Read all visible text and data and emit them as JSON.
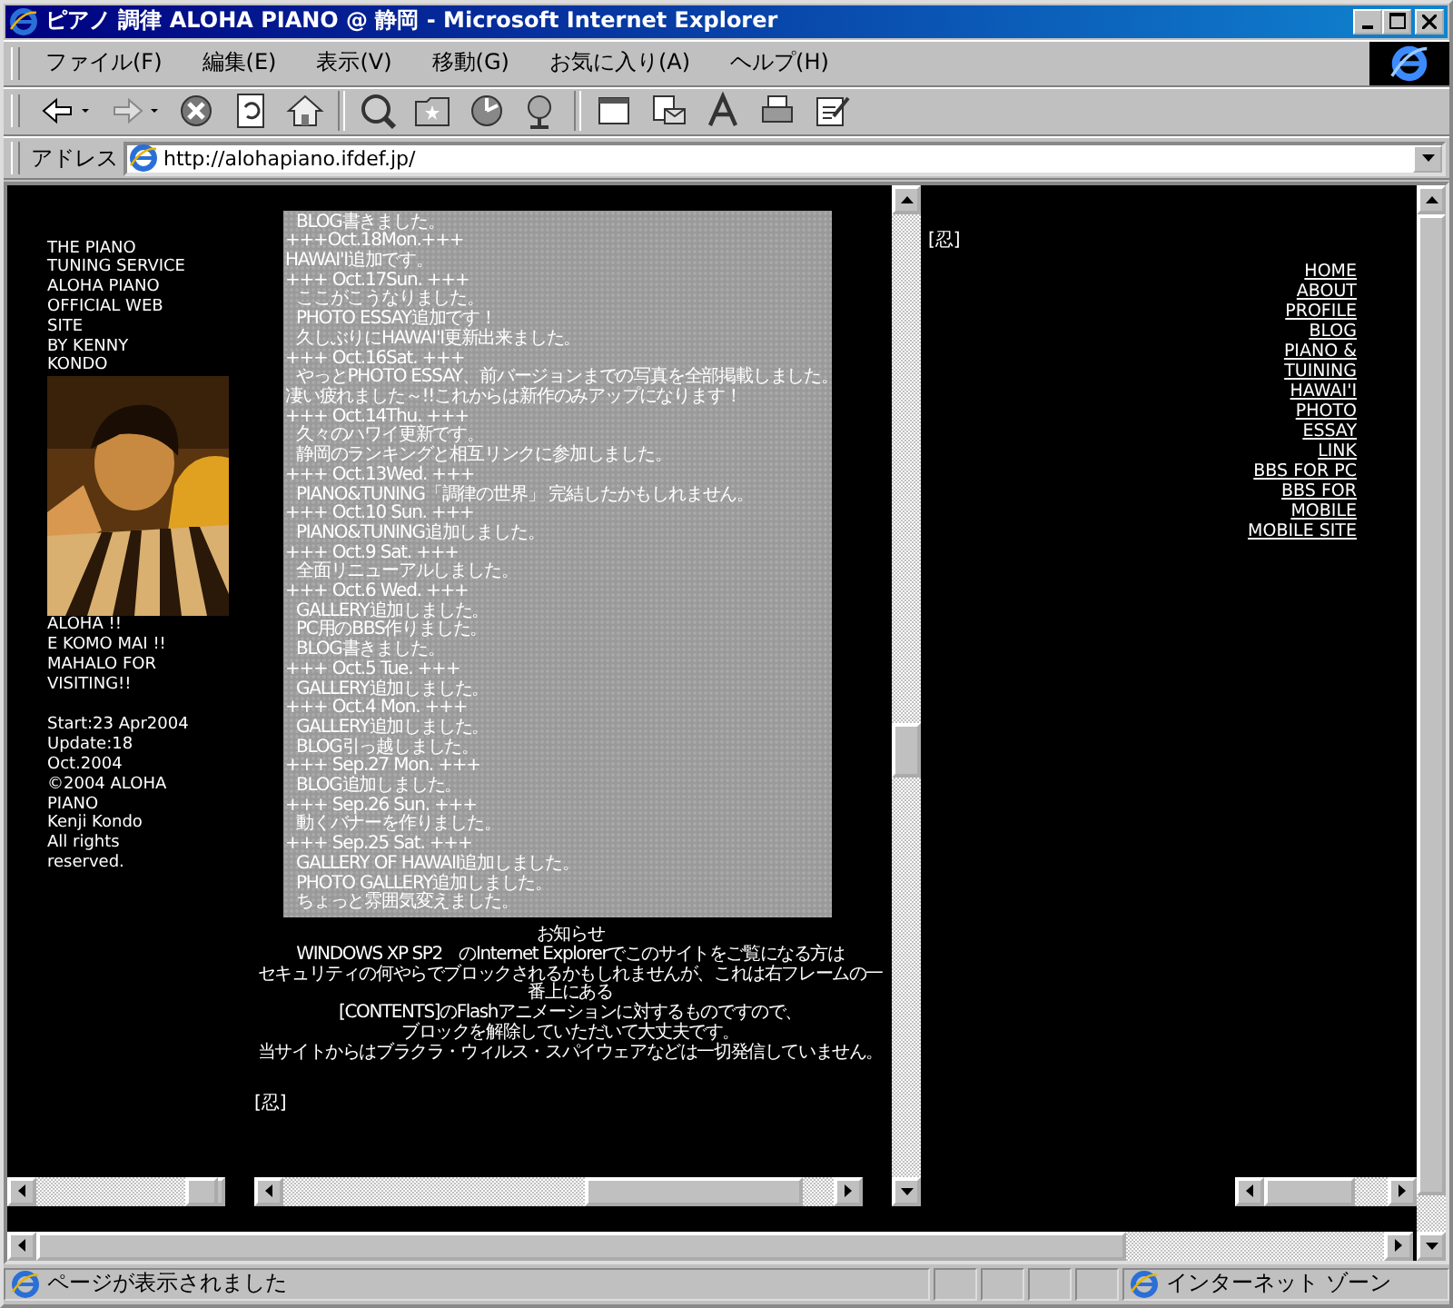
{
  "window": {
    "title": "ピアノ 調律 ALOHA PIANO @ 静岡 - Microsoft Internet Explorer"
  },
  "menu": [
    "ファイル(F)",
    "編集(E)",
    "表示(V)",
    "移動(G)",
    "お気に入り(A)",
    "ヘルプ(H)"
  ],
  "address": {
    "label": "アドレス",
    "url": "http://alohapiano.ifdef.jp/"
  },
  "left_frame": {
    "intro": [
      "THE PIANO",
      "TUNING SERVICE",
      "ALOHA PIANO",
      "OFFICIAL WEB",
      "SITE",
      "BY KENNY",
      "KONDO"
    ],
    "photo": {
      "kind": "picture"
    },
    "greeting": [
      "ALOHA !!",
      "E KOMO MAI !!",
      "MAHALO FOR",
      "VISITING!!"
    ],
    "credits": [
      "Start:23 Apr2004",
      "Update:18",
      "Oct.2004",
      "©2004 ALOHA",
      "PIANO",
      "Kenji Kondo",
      "All rights",
      "reserved."
    ]
  },
  "news": [
    {
      "kind": "entry",
      "text": "BLOG書きました。"
    },
    {
      "kind": "date",
      "text": "+++Oct.18Mon.+++"
    },
    {
      "kind": "flush",
      "text": "HAWAI'I追加です。"
    },
    {
      "kind": "date",
      "text": "+++ Oct.17Sun. +++"
    },
    {
      "kind": "entry",
      "text": "ここがこうなりました。"
    },
    {
      "kind": "entry",
      "text": "PHOTO ESSAY追加です！"
    },
    {
      "kind": "entry",
      "text": "久しぶりにHAWAI'I更新出来ました。"
    },
    {
      "kind": "date",
      "text": "+++ Oct.16Sat. +++"
    },
    {
      "kind": "entry",
      "text": "やっとPHOTO ESSAY、前バージョンまでの写真を全部掲載しました。"
    },
    {
      "kind": "flush",
      "text": "凄い疲れました～!!これからは新作のみアップになります！"
    },
    {
      "kind": "date",
      "text": "+++ Oct.14Thu. +++"
    },
    {
      "kind": "entry",
      "text": "久々のハワイ更新です。"
    },
    {
      "kind": "entry",
      "text": "静岡のランキングと相互リンクに参加しました。"
    },
    {
      "kind": "date",
      "text": "+++ Oct.13Wed. +++"
    },
    {
      "kind": "entry",
      "text": "PIANO&TUNING「調律の世界」 完結したかもしれません。"
    },
    {
      "kind": "date",
      "text": "+++ Oct.10 Sun. +++"
    },
    {
      "kind": "entry",
      "text": "PIANO&TUNING追加しました。"
    },
    {
      "kind": "date",
      "text": "+++ Oct.9 Sat. +++"
    },
    {
      "kind": "entry",
      "text": "全面リニューアルしました。"
    },
    {
      "kind": "date",
      "text": "+++ Oct.6 Wed. +++"
    },
    {
      "kind": "entry",
      "text": "GALLERY追加しました。"
    },
    {
      "kind": "entry",
      "text": "PC用のBBS作りました。"
    },
    {
      "kind": "entry",
      "text": "BLOG書きました。"
    },
    {
      "kind": "date",
      "text": "+++ Oct.5 Tue. +++"
    },
    {
      "kind": "entry",
      "text": "GALLERY追加しました。"
    },
    {
      "kind": "date",
      "text": "+++ Oct.4 Mon. +++"
    },
    {
      "kind": "entry",
      "text": "GALLERY追加しました。"
    },
    {
      "kind": "entry",
      "text": "BLOG引っ越しました。"
    },
    {
      "kind": "date",
      "text": "+++ Sep.27 Mon. +++"
    },
    {
      "kind": "entry",
      "text": "BLOG追加しました。"
    },
    {
      "kind": "date",
      "text": "+++ Sep.26 Sun. +++"
    },
    {
      "kind": "entry",
      "text": "動くバナーを作りました。"
    },
    {
      "kind": "date",
      "text": "+++ Sep.25 Sat. +++"
    },
    {
      "kind": "entry",
      "text": "GALLERY OF HAWAII追加しました。"
    },
    {
      "kind": "entry",
      "text": "PHOTO GALLERY追加しました。"
    },
    {
      "kind": "entry",
      "text": "ちょっと雰囲気変えました。"
    }
  ],
  "notice": {
    "title": "お知らせ",
    "lines": [
      "WINDOWS XP SP2　のInternet Explorerでこのサイトをご覧になる方は",
      "セキュリティの何やらでブロックされるかもしれませんが、これは右フレームの一",
      "番上にある",
      "[CONTENTS]のFlashアニメーションに対するものですので、",
      "ブロックを解除していただいて大丈夫です。",
      "当サイトからはブラクラ・ウィルス・スパイウェアなどは一切発信していません。"
    ]
  },
  "center_mark": "[忍]",
  "right_frame": {
    "mark": "[忍]",
    "nav": [
      {
        "lines": [
          "HOME"
        ]
      },
      {
        "lines": [
          "ABOUT"
        ]
      },
      {
        "lines": [
          "PROFILE"
        ]
      },
      {
        "lines": [
          "BLOG"
        ]
      },
      {
        "lines": [
          "PIANO &",
          "TUINING"
        ]
      },
      {
        "lines": [
          "HAWAI'I"
        ]
      },
      {
        "lines": [
          "PHOTO",
          "ESSAY"
        ]
      },
      {
        "lines": [
          "LINK"
        ]
      },
      {
        "lines": [
          "BBS FOR PC"
        ]
      },
      {
        "lines": [
          "BBS FOR",
          "MOBILE"
        ]
      },
      {
        "lines": [
          "MOBILE SITE"
        ]
      }
    ]
  },
  "status_bar": {
    "text": "ページが表示されました",
    "zone": "インターネット ゾーン"
  }
}
